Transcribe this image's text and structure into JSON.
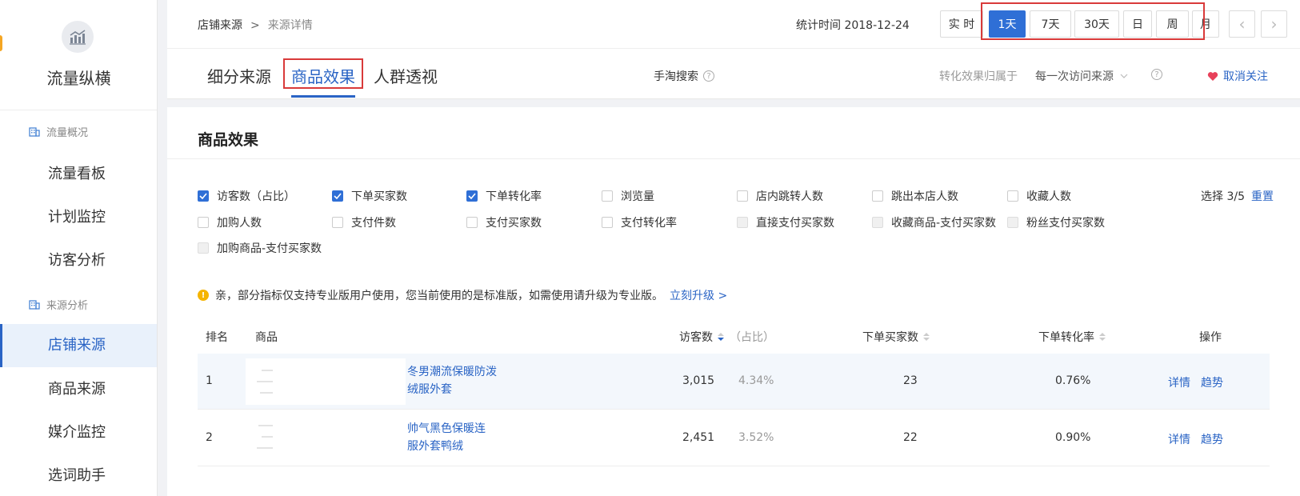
{
  "app": {
    "title": "流量纵横"
  },
  "sidebar": {
    "section1": "流量概况",
    "section2": "来源分析",
    "items": [
      {
        "label": "流量看板"
      },
      {
        "label": "计划监控"
      },
      {
        "label": "访客分析"
      },
      {
        "label": "店铺来源"
      },
      {
        "label": "商品来源"
      },
      {
        "label": "媒介监控"
      },
      {
        "label": "选词助手"
      }
    ]
  },
  "header": {
    "breadcrumb_root": "店铺来源",
    "breadcrumb_sep": ">",
    "breadcrumb_current": "来源详情",
    "stat_time": "统计时间 2018-12-24",
    "periods": [
      "实 时",
      "1天",
      "7天",
      "30天",
      "日",
      "周",
      "月"
    ],
    "selected_period": "1天",
    "prev": "‹",
    "next": "›"
  },
  "tabs": {
    "items": [
      "细分来源",
      "商品效果",
      "人群透视"
    ],
    "active": "商品效果",
    "source_label": "手淘搜索",
    "conversion_label": "转化效果归属于",
    "conversion_value": "每一次访问来源",
    "unfollow": "取消关注"
  },
  "panel": {
    "title": "商品效果",
    "pick_count": "选择 3/5",
    "reset": "重置",
    "metrics": [
      {
        "label": "访客数（占比）",
        "state": "checked"
      },
      {
        "label": "下单买家数",
        "state": "checked"
      },
      {
        "label": "下单转化率",
        "state": "checked"
      },
      {
        "label": "浏览量",
        "state": "unchecked"
      },
      {
        "label": "店内跳转人数",
        "state": "unchecked"
      },
      {
        "label": "跳出本店人数",
        "state": "unchecked"
      },
      {
        "label": "收藏人数",
        "state": "unchecked"
      },
      {
        "label": "加购人数",
        "state": "unchecked"
      },
      {
        "label": "支付件数",
        "state": "unchecked"
      },
      {
        "label": "支付买家数",
        "state": "unchecked"
      },
      {
        "label": "支付转化率",
        "state": "unchecked"
      },
      {
        "label": "直接支付买家数",
        "state": "disabled"
      },
      {
        "label": "收藏商品-支付买家数",
        "state": "disabled"
      },
      {
        "label": "粉丝支付买家数",
        "state": "disabled"
      },
      {
        "label": "加购商品-支付买家数",
        "state": "disabled"
      }
    ],
    "notice_text": "亲，部分指标仅支持专业版用户使用，您当前使用的是标准版，如需使用请升级为专业版。",
    "notice_link": "立刻升级 >"
  },
  "table": {
    "headers": {
      "rank": "排名",
      "product": "商品",
      "visitors": "访客数",
      "share": "（占比）",
      "buyers": "下单买家数",
      "rate": "下单转化率",
      "actions": "操作"
    },
    "rows": [
      {
        "rank": "1",
        "name_line1": "冬男潮流保暖防泼",
        "name_line2": "绒服外套",
        "visitors": "3,015",
        "share": "4.34%",
        "buyers": "23",
        "rate": "0.76%",
        "detail": "详情",
        "trend": "趋势"
      },
      {
        "rank": "2",
        "name_line1": "帅气黑色保暖连",
        "name_line2": "服外套鸭绒",
        "visitors": "2,451",
        "share": "3.52%",
        "buyers": "22",
        "rate": "0.90%",
        "detail": "详情",
        "trend": "趋势"
      }
    ]
  },
  "colors": {
    "accent": "#2f6fd6",
    "link": "#2a64c5",
    "highlight_box": "#d93a3a",
    "warning": "#f5b400",
    "heart": "#e8415a"
  }
}
